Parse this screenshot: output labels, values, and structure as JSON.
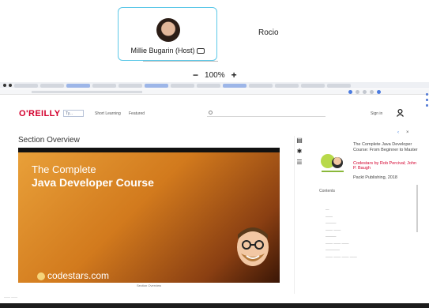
{
  "meeting": {
    "host_name": "Millie Bugarin (Host)",
    "peer_name": "Rocio",
    "zoom_minus": "−",
    "zoom_level": "100%",
    "zoom_plus": "+"
  },
  "site": {
    "logo": "O'REILLY",
    "topic_box": "Ty...",
    "nav": [
      "Short Learning",
      "Featured"
    ],
    "search_placeholder": "",
    "signin": "Sign in"
  },
  "content": {
    "section_title": "Section Overview",
    "player": {
      "line1": "The Complete",
      "line2": "Java Developer Course",
      "brand": "codestars.com",
      "caption": "Section Overview"
    },
    "bottom_text": "—— ——",
    "book": {
      "title": "The Complete Java Developer Course: From Beginner to Master",
      "authors": "Codestars by Rob Percival; John P. Baugh",
      "publisher": "Packt Publishing, 2018"
    },
    "contents_label": "Contents",
    "toc": [
      "—",
      "——",
      "———",
      "—— ——",
      "———",
      "—— —— ——",
      "————",
      "—— —— —— ——"
    ]
  },
  "colors": {
    "accent_tile": "#5cc8e8",
    "brand_red": "#d3002d",
    "player_orange": "#e9a13a"
  }
}
